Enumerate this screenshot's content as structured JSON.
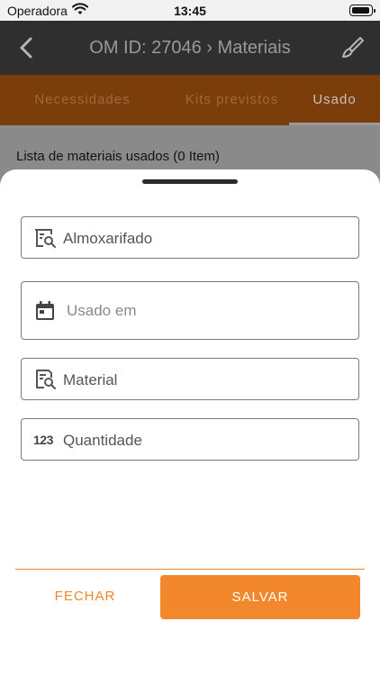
{
  "status_bar": {
    "carrier": "Operadora",
    "time": "13:45"
  },
  "app_bar": {
    "title": "OM ID: 27046 › Materiais"
  },
  "tabs": [
    {
      "label": "Necessidades",
      "active": false
    },
    {
      "label": "Kits previstos",
      "active": false
    },
    {
      "label": "Usado",
      "active": true
    }
  ],
  "list": {
    "header": "Lista de materiais usados (0 Item)"
  },
  "form": {
    "almoxarifado": {
      "placeholder": "Almoxarifado",
      "icon": "warehouse-search-icon"
    },
    "usado_em": {
      "placeholder": "Usado em",
      "icon": "calendar-icon"
    },
    "material": {
      "placeholder": "Material",
      "icon": "document-search-icon"
    },
    "quantidade": {
      "placeholder": "Quantidade",
      "icon_text": "123"
    }
  },
  "actions": {
    "close_label": "FECHAR",
    "save_label": "SALVAR"
  },
  "colors": {
    "accent": "#f2882b",
    "tab_bar": "#7b3d09",
    "app_bar": "#2f2f2f"
  }
}
